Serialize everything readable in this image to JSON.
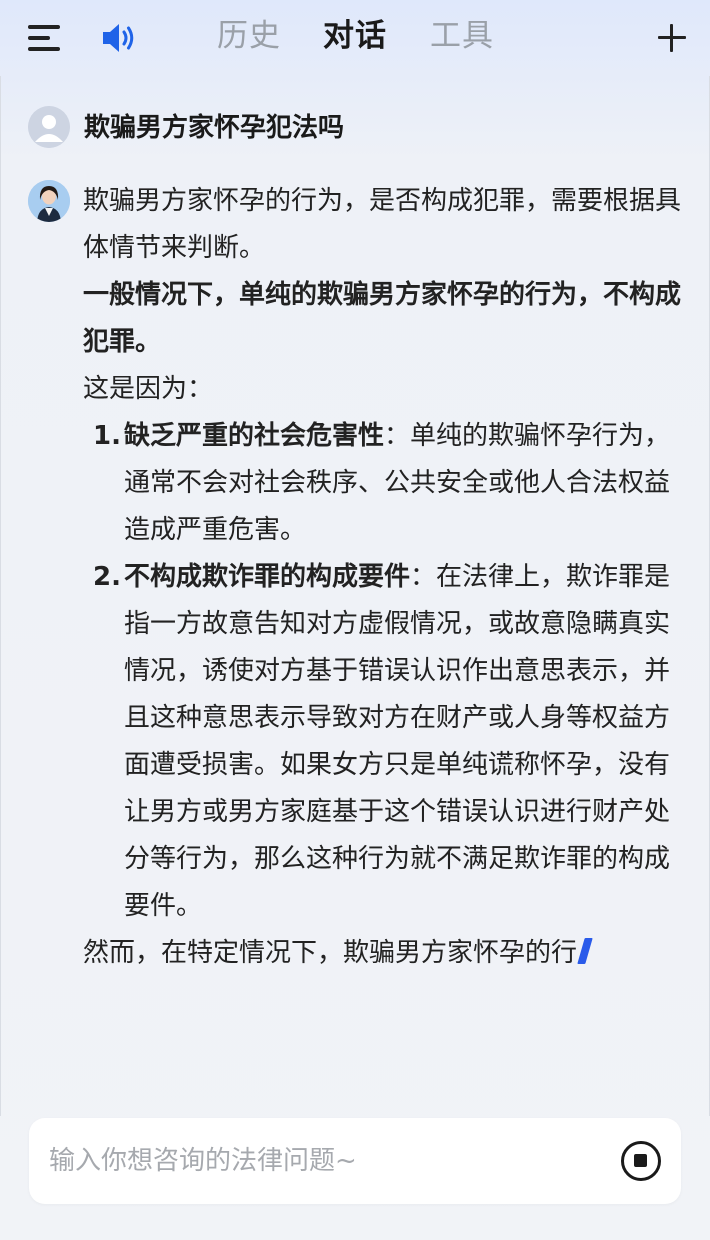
{
  "header": {
    "tabs": [
      {
        "label": "历史",
        "active": false
      },
      {
        "label": "对话",
        "active": true
      },
      {
        "label": "工具",
        "active": false
      }
    ]
  },
  "conversation": {
    "user_question": "欺骗男方家怀孕犯法吗",
    "answer": {
      "intro": "欺骗男方家怀孕的行为，是否构成犯罪，需要根据具体情节来判断。",
      "conclusion": "一般情况下，单纯的欺骗男方家怀孕的行为，不构成犯罪。",
      "reason_lead": "这是因为：",
      "reasons": [
        {
          "number": "1.",
          "title": "缺乏严重的社会危害性",
          "text": "：单纯的欺骗怀孕行为，通常不会对社会秩序、公共安全或他人合法权益造成严重危害。"
        },
        {
          "number": "2.",
          "title": "不构成欺诈罪的构成要件",
          "text": "：在法律上，欺诈罪是指一方故意告知对方虚假情况，或故意隐瞒真实情况，诱使对方基于错误认识作出意思表示，并且这种意思表示导致对方在财产或人身等权益方面遭受损害。如果女方只是单纯谎称怀孕，没有让男方或男方家庭基于这个错误认识进行财产处分等行为，那么这种行为就不满足欺诈罪的构成要件。"
        }
      ],
      "partial": "然而，在特定情况下，欺骗男方家怀孕的行"
    }
  },
  "input": {
    "placeholder": "输入你想咨询的法律问题~"
  },
  "colors": {
    "speaker_icon": "#1f63e8",
    "cursor": "#2a5bea",
    "inactive_tab": "#9aa0a8"
  },
  "icons": {
    "menu": "menu-icon",
    "speaker": "speaker-icon",
    "add": "plus-icon",
    "stop": "stop-icon"
  }
}
